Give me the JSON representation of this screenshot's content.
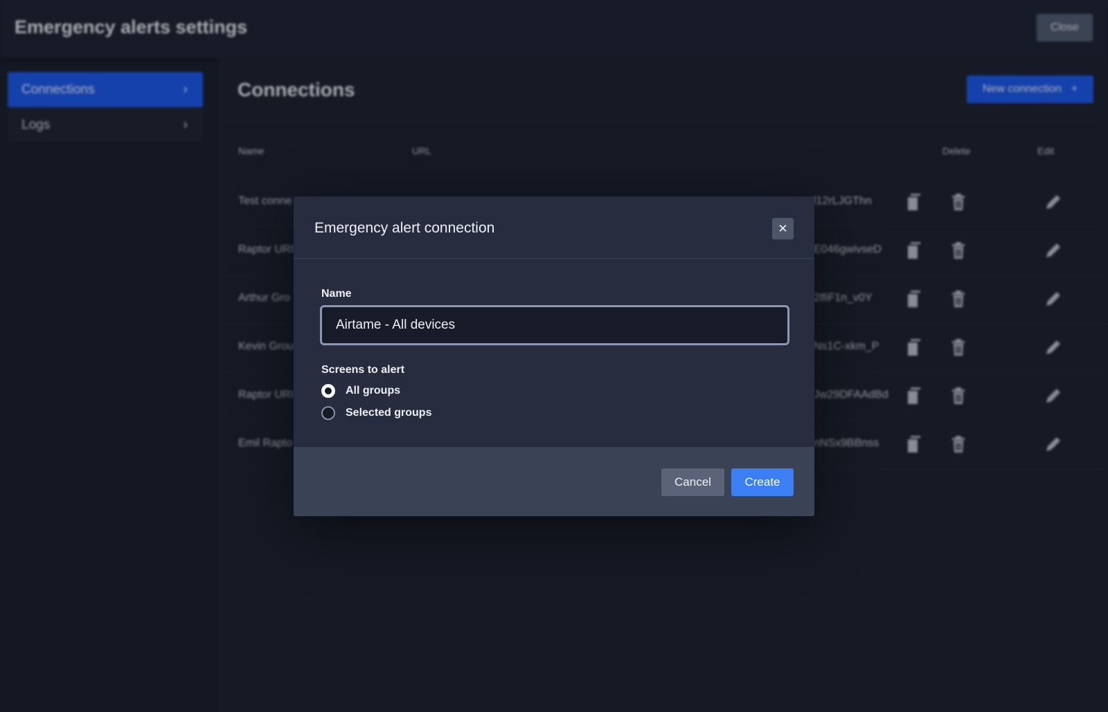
{
  "header": {
    "title": "Emergency alerts settings",
    "close_label": "Close"
  },
  "sidebar": {
    "items": [
      {
        "label": "Connections",
        "active": true
      },
      {
        "label": "Logs",
        "active": false
      }
    ]
  },
  "main": {
    "title": "Connections",
    "new_connection_label": "New connection",
    "columns": {
      "name": "Name",
      "url": "URL",
      "delete": "Delete",
      "edit": "Edit"
    },
    "rows": [
      {
        "name": "Test conne",
        "url": "l12rLJGThn"
      },
      {
        "name": "Raptor URI",
        "url": "E046gwivseD"
      },
      {
        "name": "Arthur Gro",
        "url": "2lfiF1n_v0Y"
      },
      {
        "name": "Kevin Grou",
        "url": "Ns1C-xkm_P"
      },
      {
        "name": "Raptor URI",
        "url": "Jw29DFAAdBd"
      },
      {
        "name": "Emil Rapto",
        "url": "nNSx9BBnss"
      }
    ]
  },
  "modal": {
    "title": "Emergency alert connection",
    "name_label": "Name",
    "name_value": "Airtame - All devices",
    "screens_label": "Screens to alert",
    "options": [
      {
        "label": "All groups",
        "checked": true
      },
      {
        "label": "Selected groups",
        "checked": false
      }
    ],
    "cancel_label": "Cancel",
    "create_label": "Create"
  },
  "colors": {
    "accent": "#1a56e6",
    "create": "#3c7ef4",
    "background": "#1a1e2a"
  }
}
